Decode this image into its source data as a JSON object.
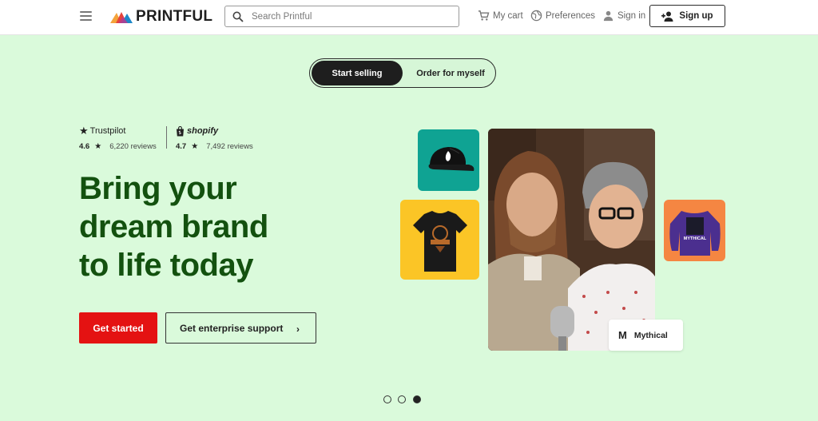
{
  "header": {
    "menu_icon": "hamburger-menu-icon",
    "logo_text": "PRINTFUL",
    "search_placeholder": "Search Printful",
    "cart_label": "My cart",
    "preferences_label": "Preferences",
    "signin_label": "Sign in",
    "signup_label": "Sign up"
  },
  "toggle": {
    "active_label": "Start selling",
    "inactive_label": "Order for myself"
  },
  "ratings": {
    "trustpilot": {
      "brand": "Trustpilot",
      "score": "4.6",
      "reviews": "6,220 reviews"
    },
    "shopify": {
      "brand": "shopify",
      "score": "4.7",
      "reviews": "7,492 reviews"
    }
  },
  "hero": {
    "headline_line1": "Bring your",
    "headline_line2": "dream brand",
    "headline_line3": "to life today",
    "primary_button": "Get started",
    "secondary_button": "Get enterprise support",
    "secondary_chevron": "›"
  },
  "media": {
    "sweat_print": "MYTHICAL",
    "badge_logo": "M",
    "badge_label": "Mythical"
  },
  "carousel": {
    "slides": 3,
    "active_index": 2
  },
  "colors": {
    "background": "#dafadb",
    "headline": "#13510f",
    "primary": "#e41212",
    "hat_tile": "#0fa393",
    "tee_tile": "#fbc526",
    "sweat_tile": "#f58642"
  }
}
